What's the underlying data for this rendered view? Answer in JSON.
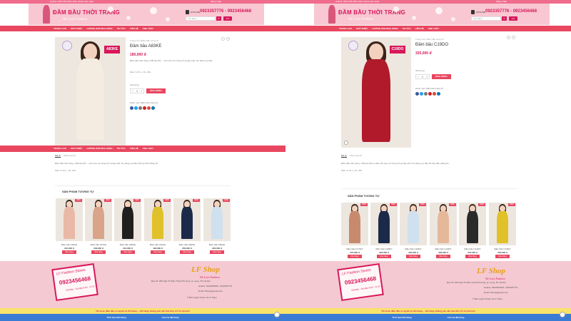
{
  "topbar": {
    "left": "Hotline: 0923 456 468 | Giao nhanh toàn quốc",
    "right": "Đăng nhập"
  },
  "header": {
    "logo_title": "ĐẦM BẦU THỜI TRANG",
    "logo_sub": "We Love Fashion",
    "hotline_label": "HOTLINE",
    "hotline": "0923357776 - 0923456468",
    "search_placeholder": "Tìm kiếm...",
    "cart_label": "0 đ"
  },
  "nav": {
    "items": [
      "TRANG CHỦ",
      "GIỚI THIỆU",
      "HƯỚNG DẪN MUA HÀNG",
      "TIN TỨC",
      "LIÊN HỆ",
      "ẢNH THẬT"
    ]
  },
  "products": [
    {
      "crumb": "Trang chủ / Đầm bầu công sở",
      "title": "Đầm bầu A83KE",
      "code": "A83KE",
      "price": "180,000 đ",
      "desc": "Đầm bầu thời trang, chất liệu đũi ... phù hợp với công sở và dạo phố, tôn dáng mẹ bầu.",
      "size": "Size: S, M, L, XL, 2XL",
      "qty_label": "Số lượng",
      "qty": "1",
      "buy": "MUA HÀNG",
      "category": "Danh mục: Đầm bầu công sở",
      "dress_color": "#f4ece0",
      "tab_desc": "Đầm bầu thời trang, chất liệu đũi ... phù hợp với công sở và dạo phố, tôn dáng mẹ bầu rất hợp đến thăng bé.",
      "tab_size": "Size: S, M, L, XL, 2XL"
    },
    {
      "crumb": "Trang chủ / Đầm bầu công sở",
      "title": "Đầm bầu C19DO",
      "code": "C19DO",
      "price": "320,000 đ",
      "desc": "",
      "size": "",
      "qty_label": "Số lượng",
      "qty": "1",
      "buy": "MUA HÀNG",
      "category": "Danh mục: Đầm bầu công sở",
      "dress_color": "#b01a2a",
      "tab_desc": "Đầm bầu thời trang, chất liệu đũi co dãn phù hợp với công sở và dạo phố, tôn dáng mẹ bầu rất hợp đến thăng bé.",
      "tab_size": "Size: S, M, L, XL, 2XL"
    }
  ],
  "tabs": {
    "desc": "Mô tả",
    "reviews": "Đánh giá (0)"
  },
  "related": {
    "title": "SẢN PHẨM TƯƠNG TỰ",
    "left": [
      {
        "name": "Đầm bầu A92KE",
        "price": "210,000 đ",
        "color": "#e9b8a7"
      },
      {
        "name": "Đầm bầu A97KE",
        "price": "230,000 đ",
        "color": "#d9a48a"
      },
      {
        "name": "Đầm bầu A95KE",
        "price": "210,000 đ",
        "color": "#1f1f1f"
      },
      {
        "name": "Đầm bầu A32KE",
        "price": "190,000 đ",
        "color": "#e1c12a"
      },
      {
        "name": "Đầm bầu A96KE",
        "price": "250,000 đ",
        "color": "#1c2a4a"
      },
      {
        "name": "Đầm bầu A90KE",
        "price": "220,000 đ",
        "color": "#cfe0ee"
      }
    ],
    "right": [
      {
        "name": "Đầm bầu C17DO",
        "price": "270,000 đ",
        "color": "#c78a6e"
      },
      {
        "name": "Đầm bầu C18DO",
        "price": "320,000 đ",
        "color": "#1c2a4a"
      },
      {
        "name": "Đầm bầu C15DO",
        "price": "260,000 đ",
        "color": "#cfe0ee"
      },
      {
        "name": "Đầm bầu C16DO",
        "price": "290,000 đ",
        "color": "#e5b89a"
      },
      {
        "name": "Đầm bầu C14DO",
        "price": "270,000 đ",
        "color": "#2a2a2a"
      },
      {
        "name": "Đầm bầu C13DO",
        "price": "250,000 đ",
        "color": "#e1c12a"
      }
    ],
    "new_badge": "NEW",
    "buy": "Mua hàng"
  },
  "footer": {
    "stamp_name": "LF Fashion Stores",
    "stamp_phone": "0923456468",
    "stamp_hours": "Monday - Sunday\n8:00 - 21:30",
    "brand": "LF Shop",
    "brand_sub": "We Love Fashion",
    "address": "Địa chỉ: 259 Ngõ 79 Kiều Thanh Phương, Q. Long, TP. Hà Nội",
    "hotline": "Hotline: 0923456468 - 0923357776",
    "email": "Email: lfshop@gmail.com",
    "copyright": "© Bản quyền thuộc về LF Shop",
    "yellow_notice": "Tất cả áo đầm đều có quyền tự đổi hàng ... đổi hàng, không yêu cầu hoá đơn, hỗ trợ tận tình",
    "left_btn": "Thời Hạn Đổi Hàng",
    "right_btn": "Liên hệ đặt hàng"
  },
  "colors": {
    "brand_pink": "#e8475f",
    "accent_red": "#d8175a",
    "footer_pink": "#f4c9d2",
    "notice_yellow": "#f9e26b",
    "cta_blue": "#3a7bd5"
  }
}
